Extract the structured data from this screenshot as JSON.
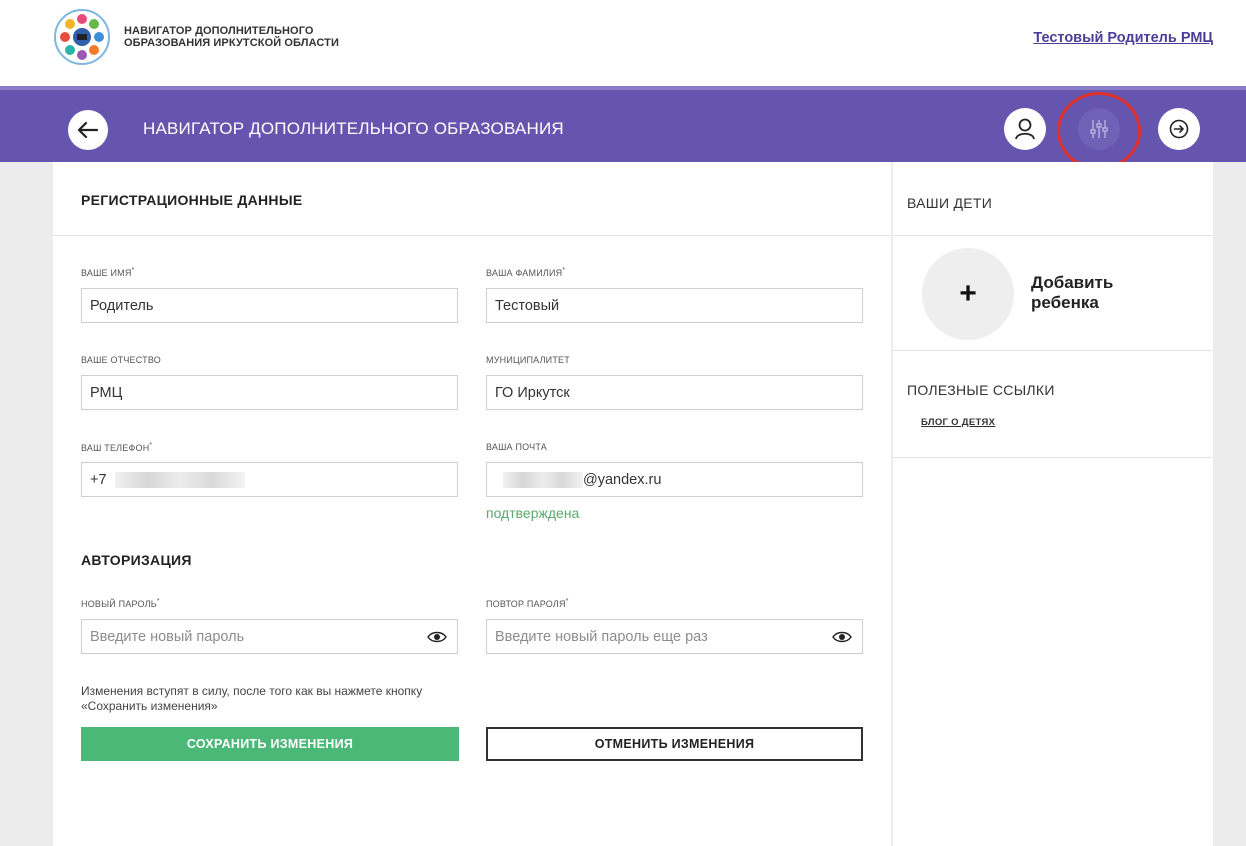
{
  "header": {
    "logo_text_line1": "НАВИГАТОР ДОПОЛНИТЕЛЬНОГО",
    "logo_text_line2": "ОБРАЗОВАНИЯ ИРКУТСКОЙ ОБЛАСТИ",
    "user_name": "Тестовый Родитель РМЦ"
  },
  "nav": {
    "title": "НАВИГАТОР ДОПОЛНИТЕЛЬНОГО ОБРАЗОВАНИЯ",
    "icons": [
      "arrow-left-icon",
      "user-icon",
      "sliders-icon",
      "exit-icon"
    ]
  },
  "registration": {
    "title": "РЕГИСТРАЦИОННЫЕ ДАННЫЕ",
    "first_name": {
      "label": "ВАШЕ ИМЯ",
      "required": "*",
      "value": "Родитель"
    },
    "last_name": {
      "label": "ВАША ФАМИЛИЯ",
      "required": "*",
      "value": "Тестовый"
    },
    "patronymic": {
      "label": "ВАШЕ ОТЧЕСТВО",
      "value": "РМЦ"
    },
    "municipality": {
      "label": "МУНИЦИПАЛИТЕТ",
      "value": "ГО Иркутск"
    },
    "phone": {
      "label": "ВАШ ТЕЛЕФОН",
      "required": "*",
      "value_prefix": "+7"
    },
    "email": {
      "label": "ВАША ПОЧТА",
      "value_suffix": "@yandex.ru",
      "status": "подтверждена"
    }
  },
  "authorization": {
    "title": "АВТОРИЗАЦИЯ",
    "new_password": {
      "label": "НОВЫЙ ПАРОЛЬ",
      "required": "*",
      "placeholder": "Введите новый пароль"
    },
    "repeat_password": {
      "label": "ПОВТОР ПАРОЛЯ",
      "required": "*",
      "placeholder": "Введите новый пароль еще раз"
    },
    "note": "Изменения вступят в силу, после того как вы нажмете кнопку «Сохранить изменения»",
    "save_label": "СОХРАНИТЬ ИЗМЕНЕНИЯ",
    "cancel_label": "ОТМЕНИТЬ ИЗМЕНЕНИЯ"
  },
  "sidebar": {
    "children_title": "ВАШИ ДЕТИ",
    "add_child_plus": "+",
    "add_child_label": "Добавить ребенка",
    "links_title": "ПОЛЕЗНЫЕ ССЫЛКИ",
    "link_blog": "БЛОГ О ДЕТЯХ"
  },
  "colors": {
    "nav_purple": "#6655ae",
    "save_green": "#4cb878",
    "confirmed_green": "#5aa86b",
    "highlight_red": "#e0312a",
    "user_link": "#4c3d96"
  }
}
